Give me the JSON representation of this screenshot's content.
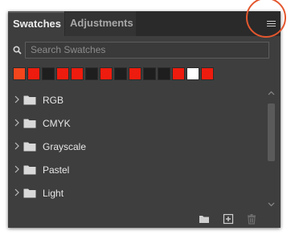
{
  "tabs": [
    {
      "label": "Swatches",
      "active": true
    },
    {
      "label": "Adjustments",
      "active": false
    }
  ],
  "search": {
    "placeholder": "Search Swatches",
    "value": ""
  },
  "recent_swatches": [
    "#f4461d",
    "#ee1c0e",
    "#1e1e1e",
    "#ee1c0e",
    "#ee1c0e",
    "#1e1e1e",
    "#ee1c0e",
    "#1e1e1e",
    "#ee1c0e",
    "#1e1e1e",
    "#1e1e1e",
    "#ee1c0e",
    "#ffffff",
    "#ee1c0e"
  ],
  "groups": [
    {
      "label": "RGB"
    },
    {
      "label": "CMYK"
    },
    {
      "label": "Grayscale"
    },
    {
      "label": "Pastel"
    },
    {
      "label": "Light"
    }
  ],
  "footer": {
    "buttons": [
      "new-group-icon",
      "new-swatch-icon",
      "delete-icon"
    ]
  },
  "colors": {
    "panel_bg": "#3e3e3e",
    "tabbar_bg": "#2a2a2a",
    "highlight": "#e4572e"
  }
}
